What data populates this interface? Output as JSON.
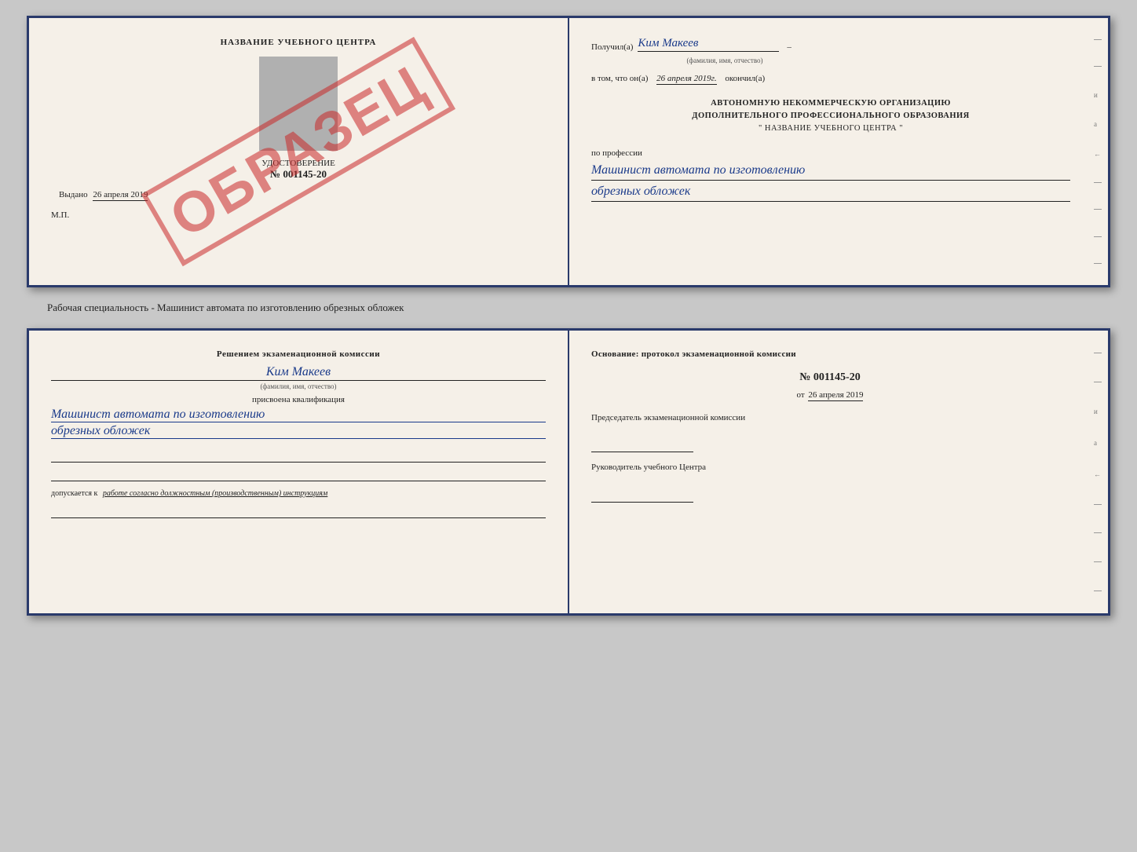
{
  "top_document": {
    "left": {
      "title": "НАЗВАНИЕ УЧЕБНОГО ЦЕНТРА",
      "watermark": "ОБРАЗЕЦ",
      "cert_label": "УДОСТОВЕРЕНИЕ",
      "cert_number": "№ 001145-20",
      "issued_label": "Выдано",
      "issued_date": "26 апреля 2019",
      "mp_label": "М.П."
    },
    "right": {
      "recipient_prefix": "Получил(а)",
      "recipient_name": "Ким Макеев",
      "fio_hint": "(фамилия, имя, отчество)",
      "date_prefix": "в том, что он(а)",
      "date_value": "26 апреля 2019г.",
      "date_suffix": "окончил(а)",
      "org_line1": "АВТОНОМНУЮ НЕКОММЕРЧЕСКУЮ ОРГАНИЗАЦИЮ",
      "org_line2": "ДОПОЛНИТЕЛЬНОГО ПРОФЕССИОНАЛЬНОГО ОБРАЗОВАНИЯ",
      "org_line3": "\" НАЗВАНИЕ УЧЕБНОГО ЦЕНТРА \"",
      "profession_label": "по профессии",
      "profession_line1": "Машинист автомата по изготовлению",
      "profession_line2": "обрезных обложек"
    }
  },
  "between_label": "Рабочая специальность - Машинист автомата по изготовлению обрезных обложек",
  "bottom_document": {
    "left": {
      "commission_title": "Решением экзаменационной комиссии",
      "commission_name": "Ким Макеев",
      "fio_hint": "(фамилия, имя, отчество)",
      "qualification_label": "присвоена квалификация",
      "qualification_line1": "Машинист автомата по изготовлению",
      "qualification_line2": "обрезных обложек",
      "admission_prefix": "допускается к",
      "admission_text": "работе согласно должностным (производственным) инструкциям"
    },
    "right": {
      "basis_title": "Основание: протокол экзаменационной комиссии",
      "protocol_number": "№ 001145-20",
      "protocol_date_prefix": "от",
      "protocol_date": "26 апреля 2019",
      "chairman_label": "Председатель экзаменационной комиссии",
      "director_label": "Руководитель учебного Центра"
    }
  },
  "side_marks": [
    "-",
    "и",
    "а",
    "←",
    "-",
    "-",
    "-",
    "-"
  ]
}
